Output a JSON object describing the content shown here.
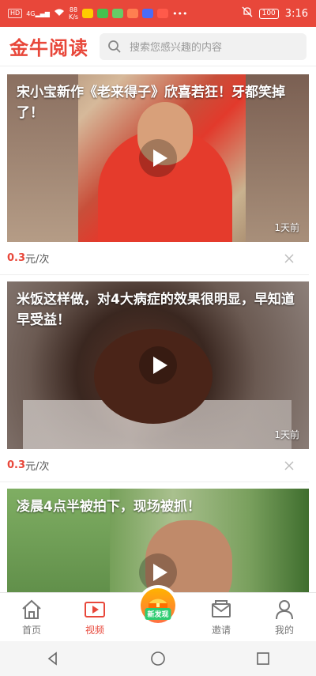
{
  "status": {
    "left_chip": "HD",
    "signal_label": "4G",
    "speed_value": "88",
    "speed_unit": "K/s",
    "battery": "100",
    "time": "3:16"
  },
  "header": {
    "logo": "金牛阅读",
    "search_placeholder": "搜索您感兴趣的内容"
  },
  "feed": [
    {
      "title": "宋小宝新作《老来得子》欣喜若狂！牙都笑掉了！",
      "time": "1天前",
      "price_value": "0.3",
      "price_unit": "元/次"
    },
    {
      "title": "米饭这样做，对4大病症的效果很明显，早知道早受益！",
      "time": "1天前",
      "price_value": "0.3",
      "price_unit": "元/次"
    },
    {
      "title": "凌晨4点半被拍下，现场被抓！"
    }
  ],
  "tabs": [
    {
      "label": "首页",
      "icon": "home-icon"
    },
    {
      "label": "视频",
      "icon": "video-icon"
    },
    {
      "label": "新发现",
      "icon": "discover-icon"
    },
    {
      "label": "邀请",
      "icon": "mail-icon"
    },
    {
      "label": "我的",
      "icon": "user-icon"
    }
  ],
  "colors": {
    "accent": "#e8473a",
    "status_bg": "#e8473a"
  }
}
